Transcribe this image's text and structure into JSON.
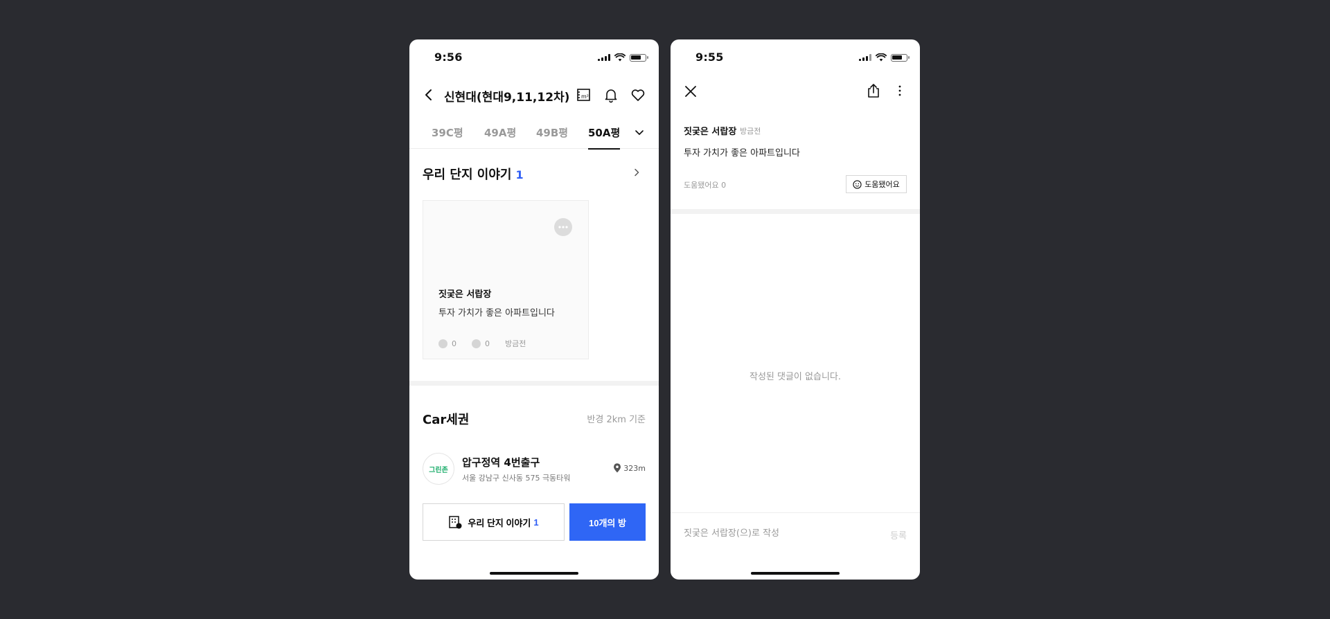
{
  "left": {
    "status": {
      "time": "9:56"
    },
    "header": {
      "title": "신현대(현대9,11,12차)"
    },
    "tabs": [
      "39C평",
      "49A평",
      "49B평",
      "50A평"
    ],
    "story": {
      "title": "우리 단지 이야기",
      "count": "1",
      "card": {
        "author": "짓궂은 서랍장",
        "body": "투자 가치가 좋은 아파트입니다",
        "likes": "0",
        "comments": "0",
        "time": "방금전"
      }
    },
    "car": {
      "title": "Car세권",
      "radius": "반경 2km 기준",
      "place": {
        "logo": "그린존",
        "name": "압구정역 4번출구",
        "address": "서울 강남구 신사동 575 극동타워",
        "distance": "323m"
      }
    },
    "bottom": {
      "story_label": "우리 단지 이야기",
      "story_count": "1",
      "rooms_label": "10개의 방"
    }
  },
  "right": {
    "status": {
      "time": "9:55"
    },
    "post": {
      "author": "짓궂은 서랍장",
      "time": "방금전",
      "body": "투자 가치가 좋은 아파트입니다",
      "help_count": "도움됐어요 0",
      "help_button": "도움됐어요"
    },
    "empty_text": "작성된 댓글이 없습니다.",
    "input": {
      "placeholder": "짓궂은 서랍장(으)로 작성",
      "submit": "등록"
    }
  },
  "colors": {
    "accent": "#2f66f5",
    "background": "#2a2b30",
    "green": "#1fae6d"
  }
}
